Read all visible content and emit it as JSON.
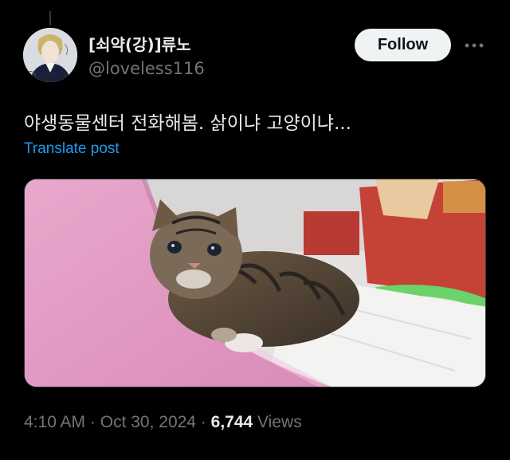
{
  "author": {
    "display_name": "[쇠약(강)]류노",
    "handle": "@loveless116"
  },
  "follow_label": "Follow",
  "more_icon": "more-horizontal-icon",
  "post": {
    "text": "야생동물센터 전화해봄. 삵이냐 고양이냐...",
    "translate_label": "Translate post"
  },
  "meta": {
    "time": "4:10 AM",
    "sep1": " · ",
    "date": "Oct 30, 2024",
    "sep2": " · ",
    "views_count": "6,744",
    "views_label": " Views"
  },
  "colors": {
    "background": "#000000",
    "text_primary": "#e7e9ea",
    "text_secondary": "#71767b",
    "link": "#1d9bf0",
    "follow_bg": "#eff3f4"
  }
}
